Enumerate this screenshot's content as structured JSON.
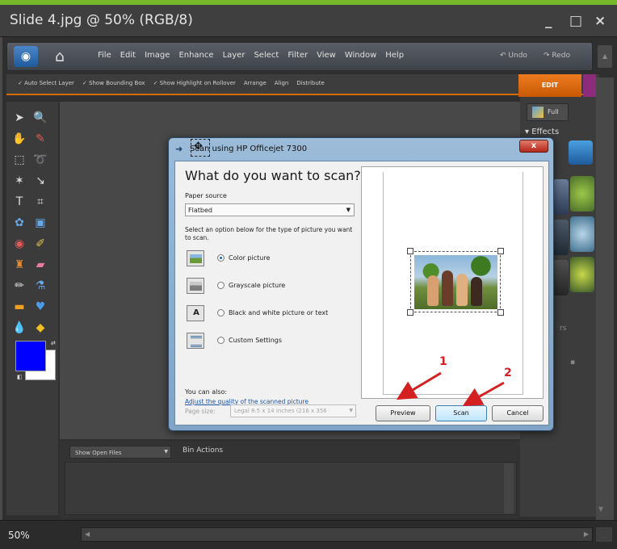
{
  "window": {
    "title": "Slide 4.jpg @ 50% (RGB/8)",
    "minimize": "_",
    "maximize": "□",
    "close": "×"
  },
  "menubar": {
    "items": [
      "File",
      "Edit",
      "Image",
      "Enhance",
      "Layer",
      "Select",
      "Filter",
      "View",
      "Window",
      "Help"
    ],
    "undo": "Undo",
    "redo": "Redo"
  },
  "options": {
    "auto_select": "✓ Auto Select Layer",
    "show_bounding": "✓ Show Bounding Box",
    "show_highlight": "✓ Show Highlight on Rollover",
    "arrange": "Arrange",
    "align": "Align",
    "distribute": "Distribute"
  },
  "panel": {
    "mode_tab": "EDIT",
    "full_label": "Full",
    "effects_label": "▾ Effects"
  },
  "bin": {
    "show_open_files": "Show Open Files",
    "bin_actions": "Bin Actions"
  },
  "status": {
    "zoom": "50%"
  },
  "dialog": {
    "title": "Scan using HP Officejet 7300",
    "heading": "What do you want to scan?",
    "paper_source_label": "Paper source",
    "paper_source_value": "Flatbed",
    "help_text": "Select an option below for the type of picture you want to scan.",
    "options": [
      {
        "label": "Color picture",
        "selected": true,
        "icon": "color-picture-icon"
      },
      {
        "label": "Grayscale picture",
        "selected": false,
        "icon": "grayscale-picture-icon"
      },
      {
        "label": "Black and white picture or text",
        "selected": false,
        "icon": "bw-text-icon"
      },
      {
        "label": "Custom Settings",
        "selected": false,
        "icon": "custom-settings-icon"
      }
    ],
    "you_can_also": "You can also:",
    "adjust_link": "Adjust the quality of the scanned picture",
    "page_size_label": "Page size:",
    "page_size_value": "Legal 8.5 x 14 inches (216 x 356",
    "preview_button": "Preview",
    "scan_button": "Scan",
    "cancel_button": "Cancel"
  },
  "annotations": {
    "step1": "1",
    "step2": "2"
  },
  "colors": {
    "accent_orange": "#d16d0a",
    "foreground_color": "#0000ff",
    "background_color": "#ffffff",
    "annotation_red": "#d42020"
  }
}
